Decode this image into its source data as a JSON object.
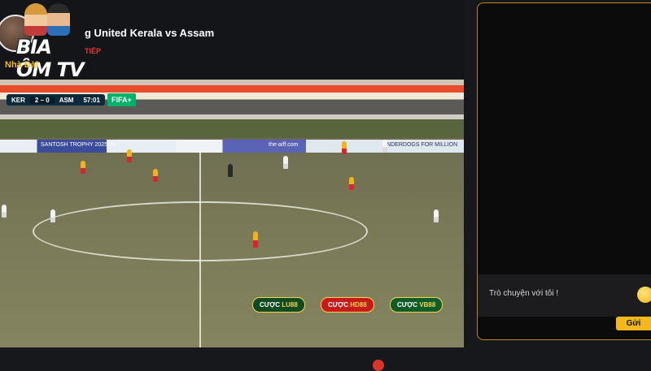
{
  "header": {
    "brand": "BIA ÔM TV",
    "brand_sub": "Nhà Đài",
    "match_title": "g United Kerala vs Assam",
    "live_label": "TIẾP"
  },
  "scorebug": {
    "home": "KER",
    "score": "2 – 0",
    "away": "ASM",
    "clock": "57:01",
    "badge": "FIFA+"
  },
  "ad_boards": [
    "SANTOSH TROPHY 2025-26",
    "the-aiff.com",
    "UNDERDOGS FOR MILLION"
  ],
  "bets": [
    {
      "prefix": "CƯỢC",
      "brand": "LU88"
    },
    {
      "prefix": "CƯỢC",
      "brand": "HD88"
    },
    {
      "prefix": "CƯỢC",
      "brand": "VB88"
    }
  ],
  "chat": {
    "placeholder": "Trò chuyện với tôi !",
    "send_label": "Gửi"
  },
  "colors": {
    "accent": "#f2b81c",
    "live_red": "#e23a2e",
    "home_kit": "#f2b21c",
    "away_kit": "#f4f4f4"
  },
  "icons": [
    "emoji-icon"
  ]
}
